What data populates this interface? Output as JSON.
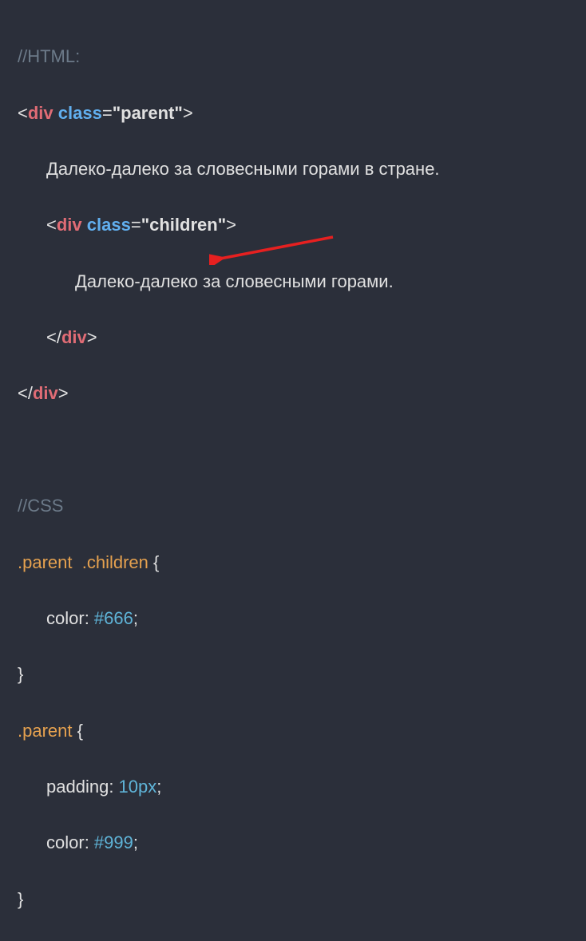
{
  "html": {
    "comment": "//HTML:",
    "open_div": {
      "bracket_open": "<",
      "tag": "div",
      "attr": "class",
      "eq": "=",
      "val": "\"parent\"",
      "bracket_close": ">"
    },
    "text1": "Далеко-далеко за словесными горами в стране.",
    "open_child": {
      "bracket_open": "<",
      "tag": "div",
      "attr": "class",
      "eq": "=",
      "val": "\"children\"",
      "bracket_close": ">"
    },
    "text2": "Далеко-далеко за словесными горами.",
    "close_child": {
      "bracket_open": "</",
      "tag": "div",
      "bracket_close": ">"
    },
    "close_div": {
      "bracket_open": "</",
      "tag": "div",
      "bracket_close": ">"
    }
  },
  "css": {
    "comment": "//CSS",
    "rule1": {
      "selector": ".parent  .children",
      "brace_open": "{",
      "prop1": "color",
      "val1": "#666",
      "brace_close": "}"
    },
    "rule2": {
      "selector": ".parent",
      "brace_open": "{",
      "prop1": "padding",
      "val1": "10px",
      "prop2": "color",
      "val2": "#999",
      "brace_close": "}"
    }
  }
}
